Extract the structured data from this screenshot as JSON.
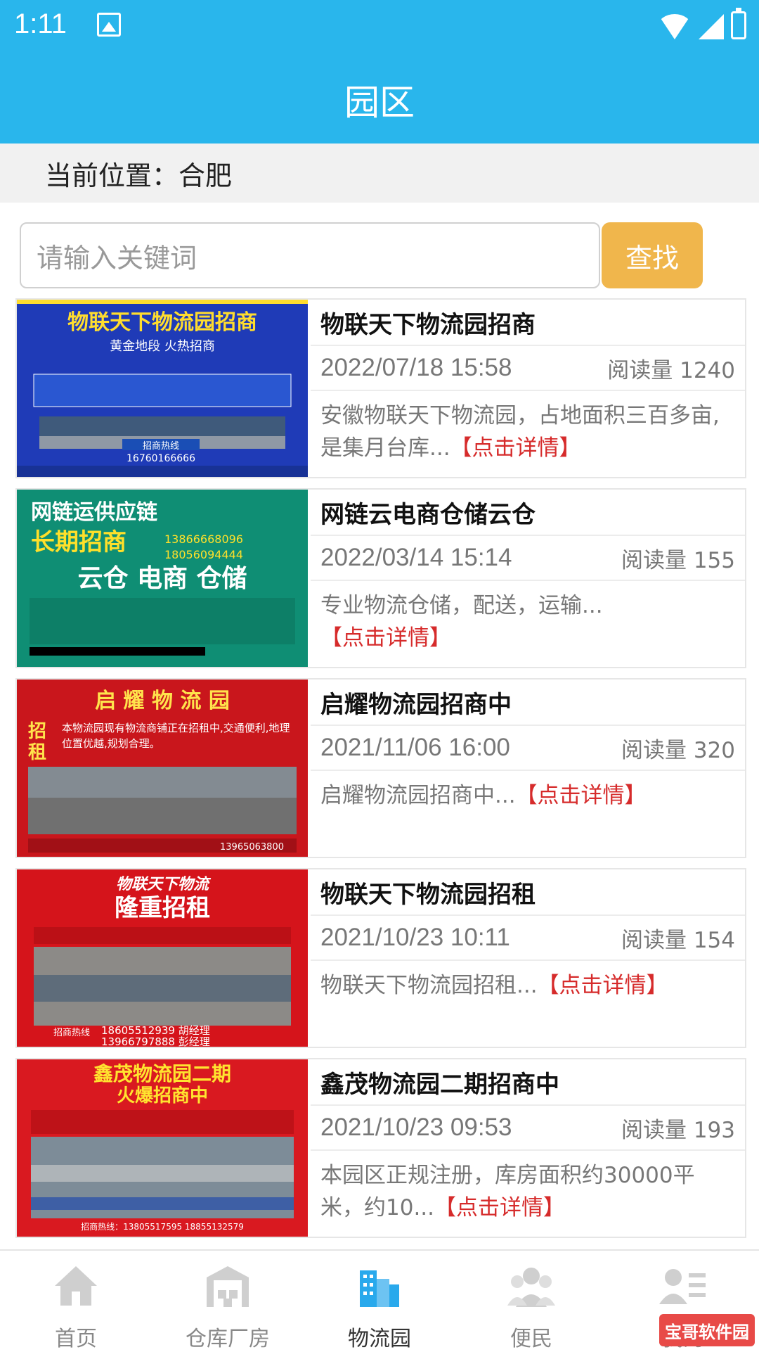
{
  "status_bar": {
    "time": "1:11"
  },
  "header": {
    "title": "园区"
  },
  "location": {
    "label": "当前位置：合肥"
  },
  "search": {
    "placeholder": "请输入关键词",
    "button_label": "查找"
  },
  "items": [
    {
      "title": "物联天下物流园招商",
      "date": "2022/07/18 15:58",
      "views": "阅读量 1240",
      "desc": "安徽物联天下物流园，占地面积三百多亩,是集月台库...",
      "detail": "【点击详情】",
      "image_text": [
        "物联天下物流园招商",
        "黄金地段 火热招商",
        "招商热线",
        "16760166666"
      ],
      "colors": {
        "bg": "#1f3bb7",
        "accent": "#ffdd2e"
      }
    },
    {
      "title": "网链云电商仓储云仓",
      "date": "2022/03/14 15:14",
      "views": "阅读量 155",
      "desc": "专业物流仓储，配送，运输...",
      "detail": "【点击详情】",
      "image_text": [
        "网链运供应链",
        "长期招商",
        "云仓 电商 仓储",
        "13866668096",
        "18056094444"
      ],
      "colors": {
        "bg": "#0f8e74",
        "accent": "#ffe02a"
      }
    },
    {
      "title": "启耀物流园招商中",
      "date": "2021/11/06 16:00",
      "views": "阅读量 320",
      "desc": "启耀物流园招商中...",
      "detail": "【点击详情】",
      "image_text": [
        "启 耀 物 流 园",
        "招",
        "租",
        "本物流园现有物流商铺正在招租中,交通便利,地理位置优越,规划合理。",
        "13965063800"
      ],
      "colors": {
        "bg": "#c9161c",
        "accent": "#ffe34c"
      }
    },
    {
      "title": "物联天下物流园招租",
      "date": "2021/10/23 10:11",
      "views": "阅读量 154",
      "desc": "物联天下物流园招租...",
      "detail": "【点击详情】",
      "image_text": [
        "物联天下物流",
        "隆重招租",
        "招商热线",
        "18605512939 胡经理",
        "13966797888 彭经理"
      ],
      "colors": {
        "bg": "#d5141b",
        "accent": "#ffffff"
      }
    },
    {
      "title": "鑫茂物流园二期招商中",
      "date": "2021/10/23 09:53",
      "views": "阅读量 193",
      "desc": "本园区正规注册，库房面积约30000平米，约10...",
      "detail": "【点击详情】",
      "image_text": [
        "鑫茂物流园二期",
        "火爆招商中",
        "招商热线：13805517595 18855132579"
      ],
      "colors": {
        "bg": "#d91920",
        "accent": "#ffe42f"
      }
    }
  ],
  "nav": [
    {
      "label": "首页",
      "icon": "home-icon"
    },
    {
      "label": "仓库厂房",
      "icon": "warehouse-icon"
    },
    {
      "label": "物流园",
      "icon": "logistics-park-icon"
    },
    {
      "label": "便民",
      "icon": "people-icon"
    },
    {
      "label": "我的",
      "icon": "profile-icon"
    }
  ],
  "watermark": {
    "text": "宝哥软件园"
  }
}
